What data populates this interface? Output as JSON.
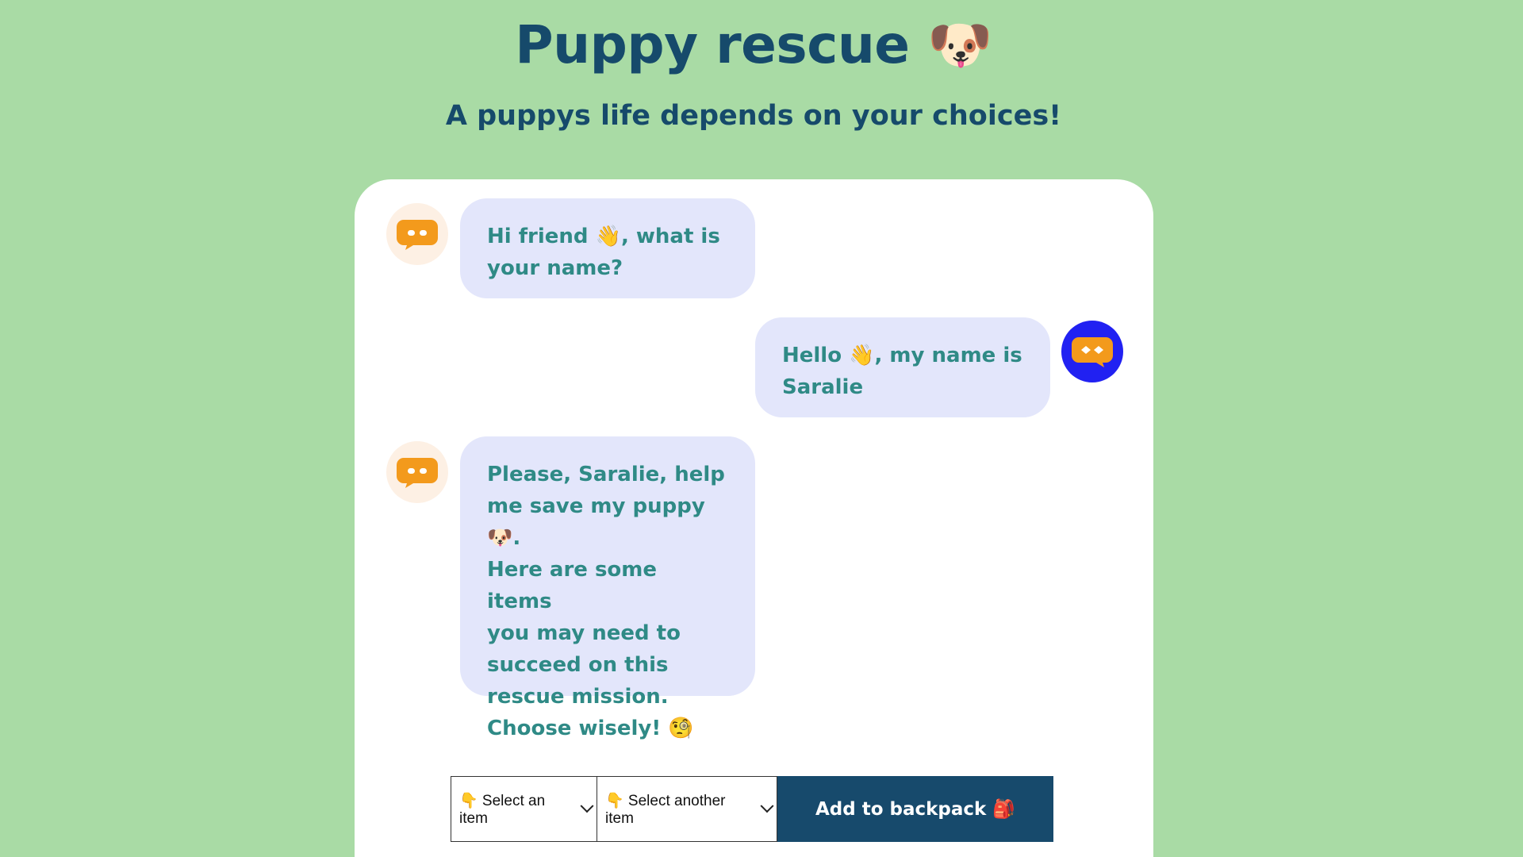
{
  "header": {
    "title": "Puppy rescue 🐶",
    "subtitle": "A puppys life depends on your choices!"
  },
  "chat": {
    "messages": [
      {
        "sender": "bot",
        "text": "Hi friend 👋, what is\nyour name?"
      },
      {
        "sender": "user",
        "text": "Hello 👋, my name is\nSaralie"
      },
      {
        "sender": "bot",
        "text": "Please, Saralie, help\nme save my puppy 🐶.\nHere are some items\nyou may need to\nsucceed on this\nrescue mission.\nChoose wisely! 🧐"
      }
    ]
  },
  "controls": {
    "select_item_label": "👇 Select an item",
    "select_another_label": "👇 Select another item",
    "add_button_label": "Add to backpack 🎒"
  },
  "colors": {
    "background": "#a9dba5",
    "heading": "#164a6b",
    "bubble": "#e3e6fb",
    "bubble_text": "#2f8a86",
    "bot_icon": "#f39a1c",
    "user_avatar": "#2121f2",
    "button": "#174a6c"
  }
}
